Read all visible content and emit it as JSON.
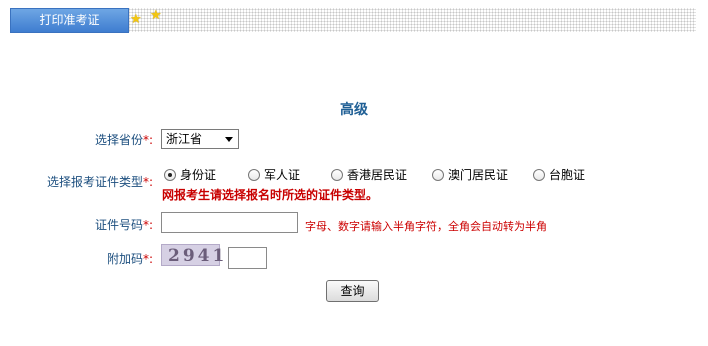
{
  "header": {
    "tab_label": "打印准考证"
  },
  "main": {
    "title": "高级",
    "province": {
      "label": "选择省份",
      "required_mark": "*:",
      "value": "浙江省"
    },
    "id_type": {
      "label": "选择报考证件类型",
      "required_mark": "*:",
      "options": [
        "身份证",
        "军人证",
        "香港居民证",
        "澳门居民证",
        "台胞证"
      ],
      "selected": "身份证",
      "note": "网报考生请选择报名时所选的证件类型。"
    },
    "id_number": {
      "label": "证件号码",
      "required_mark": "*:",
      "value": "",
      "hint": "字母、数字请输入半角字符，全角会自动转为半角"
    },
    "captcha": {
      "label": "附加码",
      "required_mark": "*:",
      "image_text": "2941",
      "value": ""
    },
    "submit_label": "查询"
  },
  "colors": {
    "tab_blue": "#3f7dd0",
    "label_blue": "#1d4f7f",
    "title_blue": "#1f5f95",
    "required_red": "#cc0000",
    "star_gold": "#f3c610"
  }
}
